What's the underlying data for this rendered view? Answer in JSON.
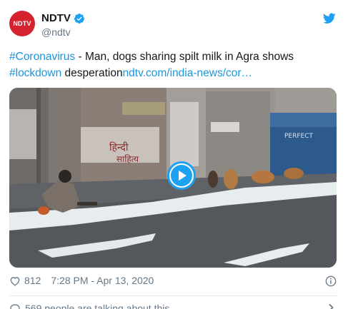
{
  "author": {
    "avatar_text": "NDTV",
    "display_name": "NDTV",
    "handle": "@ndtv",
    "verified_icon": "verified-badge-icon"
  },
  "tweet": {
    "hashtag1": "#Coronavirus",
    "text1": " - Man, dogs sharing spilt milk in Agra shows ",
    "hashtag2": "#lockdown",
    "text2": " desperation",
    "link": "ndtv.com/india-news/cor…"
  },
  "media": {
    "type": "video",
    "play_icon": "play-icon",
    "sign_text_1": "हिन्दी",
    "sign_text_2": "साहित्य",
    "sign_text_3": "PERFECT"
  },
  "meta": {
    "likes": "812",
    "timestamp": "7:28 PM - Apr 13, 2020"
  },
  "footer": {
    "talking": "569 people are talking about this"
  },
  "colors": {
    "link": "#1b95e0",
    "brand_red": "#d4232f",
    "twitter_blue": "#1da1f2",
    "muted": "#657786"
  }
}
